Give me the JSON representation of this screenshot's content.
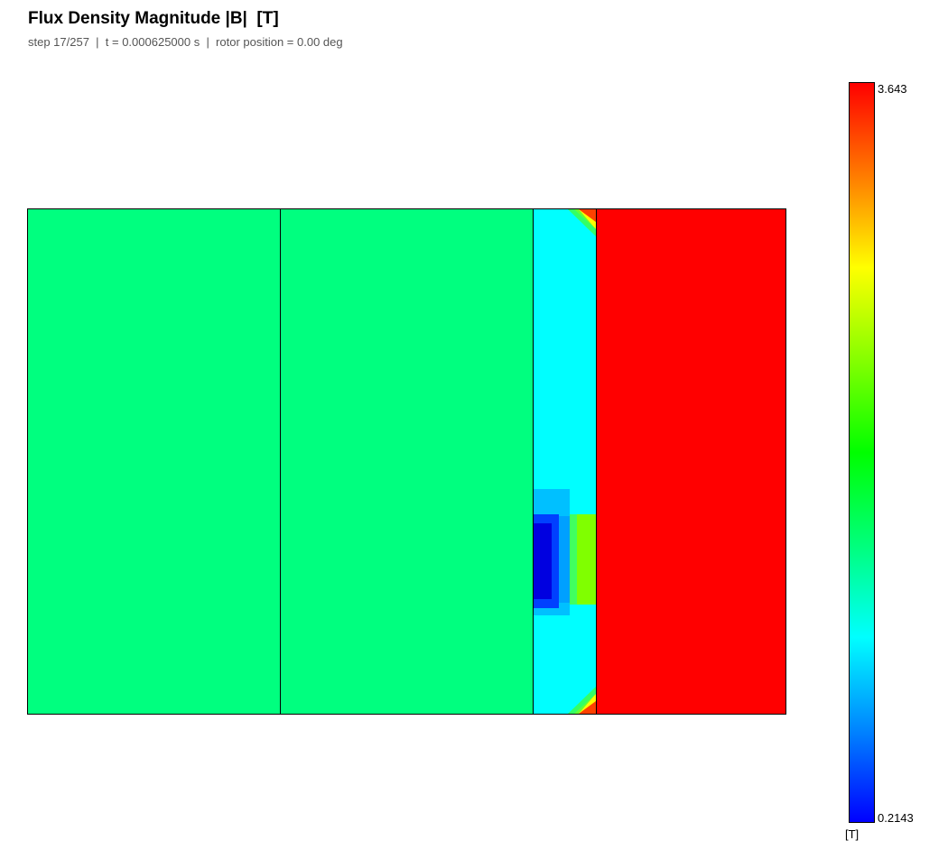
{
  "title": "Flux Density Magnitude |B|  [T]",
  "subtitle": "step 17/257  |  t = 0.000625000 s  |  rotor position = 0.00 deg",
  "colorbar": {
    "max_label": "3.643",
    "min_label": "0.2143",
    "unit_label": "[T]",
    "max": 3.643,
    "min": 0.2143,
    "colormap": "jet (blue-cyan-green-yellow-red)"
  },
  "chart_data": {
    "type": "heatmap",
    "title": "Flux Density Magnitude |B|  [T]",
    "quantity": "|B|",
    "unit": "T",
    "step": 17,
    "total_steps": 257,
    "time_s": 0.000625,
    "rotor_position_deg": 0.0,
    "color_range": [
      0.2143,
      3.643
    ],
    "regions": [
      {
        "index": 1,
        "approx_value": 1.65,
        "color": "#00ff80",
        "description": "uniform green"
      },
      {
        "index": 2,
        "approx_value": 1.65,
        "color": "#00ff80",
        "description": "uniform green"
      },
      {
        "index": 3,
        "approx_value": 1.1,
        "color": "#00ffff",
        "description": "mostly cyan, low-field pocket near lower part down to ~0.2, green/yellow corners at top-right and bottom-right"
      },
      {
        "index": 4,
        "approx_value": 3.643,
        "color": "#ff0000",
        "description": "uniform red"
      }
    ]
  }
}
